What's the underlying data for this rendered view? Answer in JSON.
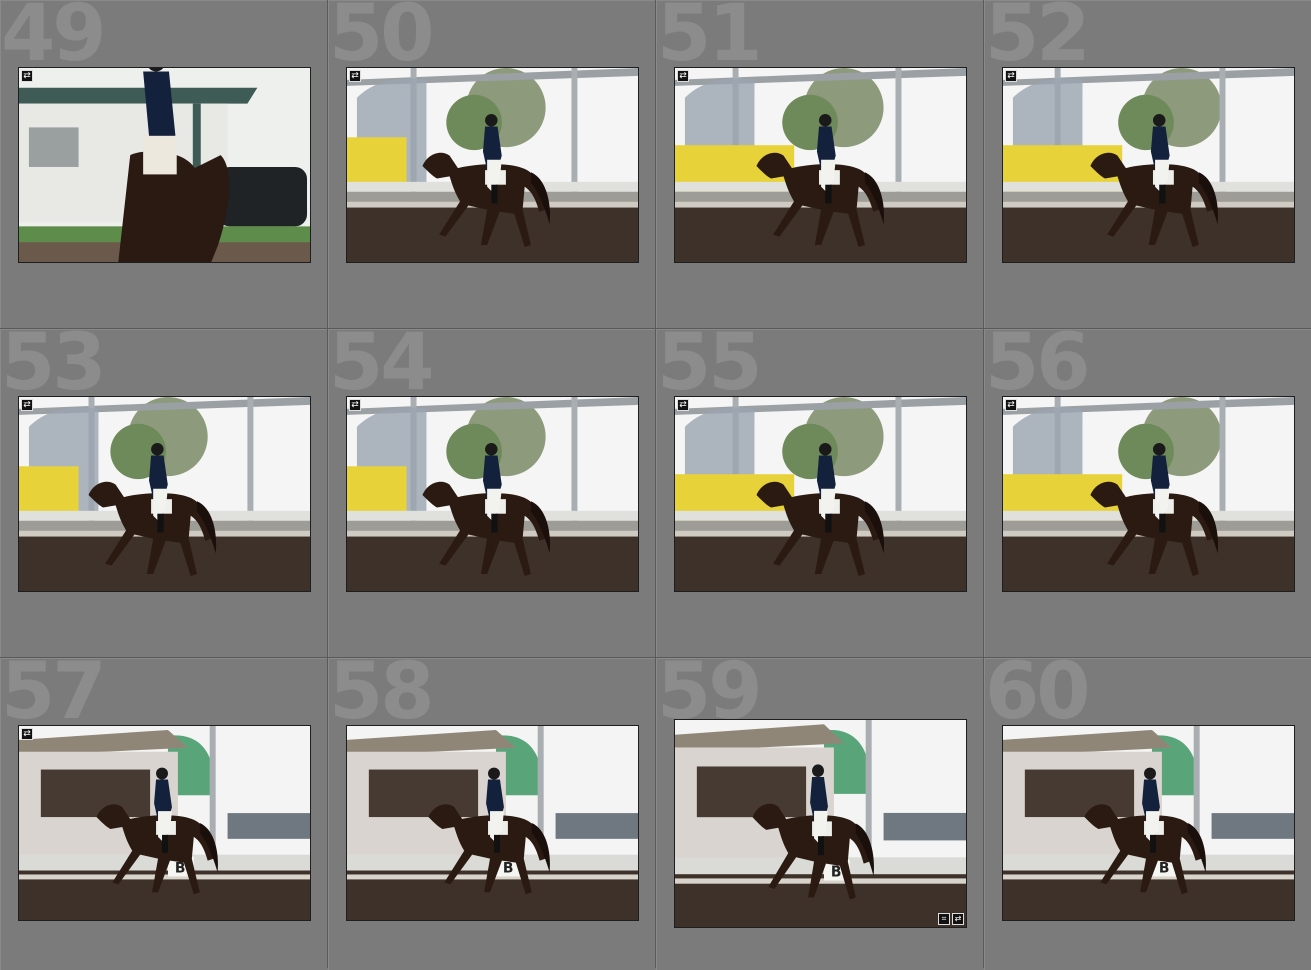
{
  "grid": {
    "cells": [
      {
        "number": "49",
        "scene": "barn",
        "badge_icon": "develop-settings-icon"
      },
      {
        "number": "50",
        "scene": "arena",
        "badge_icon": "develop-settings-icon"
      },
      {
        "number": "51",
        "scene": "arena",
        "badge_icon": "develop-settings-icon"
      },
      {
        "number": "52",
        "scene": "arena",
        "badge_icon": "develop-settings-icon"
      },
      {
        "number": "53",
        "scene": "arena",
        "badge_icon": "develop-settings-icon"
      },
      {
        "number": "54",
        "scene": "arena",
        "badge_icon": "develop-settings-icon"
      },
      {
        "number": "55",
        "scene": "arena",
        "badge_icon": "develop-settings-icon"
      },
      {
        "number": "56",
        "scene": "arena",
        "badge_icon": "develop-settings-icon"
      },
      {
        "number": "57",
        "scene": "booth",
        "badge_icon": "develop-settings-icon"
      },
      {
        "number": "58",
        "scene": "booth",
        "badge_icon": "none"
      },
      {
        "number": "59",
        "scene": "booth",
        "badge_icon": "crop-and-develop-icons"
      },
      {
        "number": "60",
        "scene": "booth",
        "badge_icon": "none"
      }
    ]
  },
  "colors": {
    "cell_bg": "#7b7b7b",
    "number_color": "#8c8c8c",
    "arena_dirt": "#3d3129",
    "horse": "#2a1a12",
    "trailer_yellow": "#e8d23a"
  }
}
